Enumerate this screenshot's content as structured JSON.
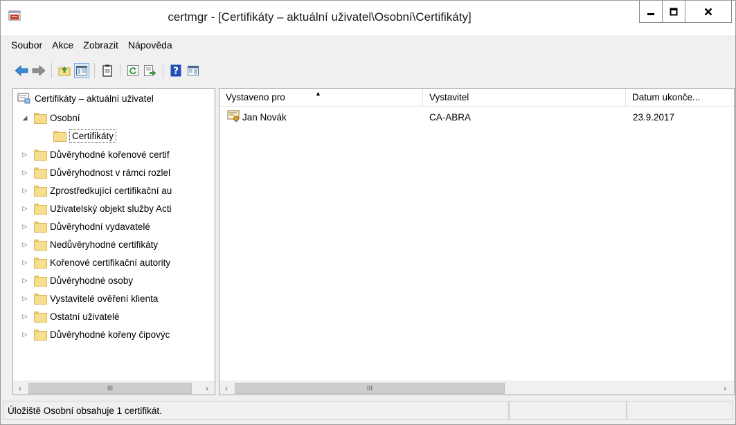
{
  "window": {
    "title": "certmgr - [Certifikáty – aktuální uživatel\\Osobní\\Certifikáty]"
  },
  "menu": [
    "Soubor",
    "Akce",
    "Zobrazit",
    "Nápověda"
  ],
  "toolbar": {
    "icons": [
      "back-icon",
      "forward-icon",
      "up-folder-icon",
      "show-hide-tree-icon",
      "clipboard-icon",
      "refresh-icon",
      "export-list-icon",
      "help-icon",
      "properties-icon"
    ]
  },
  "tree": {
    "root": "Certifikáty – aktuální uživatel",
    "nodes": [
      {
        "label": "Osobní",
        "expanded": true
      },
      {
        "label": "Certifikáty",
        "selected": true
      },
      {
        "label": "Důvěryhodné kořenové certif"
      },
      {
        "label": "Důvěryhodnost v rámci rozlel"
      },
      {
        "label": "Zprostředkující certifikační au"
      },
      {
        "label": "Uživatelský objekt služby Acti"
      },
      {
        "label": "Důvěryhodní vydavatelé"
      },
      {
        "label": "Nedůvěryhodné certifikáty"
      },
      {
        "label": "Kořenové certifikační autority"
      },
      {
        "label": "Důvěryhodné osoby"
      },
      {
        "label": "Vystavitelé ověření klienta"
      },
      {
        "label": "Ostatní uživatelé"
      },
      {
        "label": "Důvěryhodné kořeny čipovýc"
      }
    ],
    "scroll_thumb_label": "III"
  },
  "list": {
    "columns": [
      "Vystaveno pro",
      "Vystavitel",
      "Datum ukonče..."
    ],
    "sorted_column": "Vystaveno pro",
    "rows": [
      {
        "issued_to": "Jan Novák",
        "issuer": "CA-ABRA",
        "expiration": "23.9.2017"
      }
    ],
    "scroll_thumb_label": "III"
  },
  "status": {
    "text": "Úložiště Osobní obsahuje 1 certifikát."
  },
  "colors": {
    "folder": "#f7dd8e",
    "back_arrow": "#3a8ad6",
    "help_blue": "#1f4fb4"
  }
}
